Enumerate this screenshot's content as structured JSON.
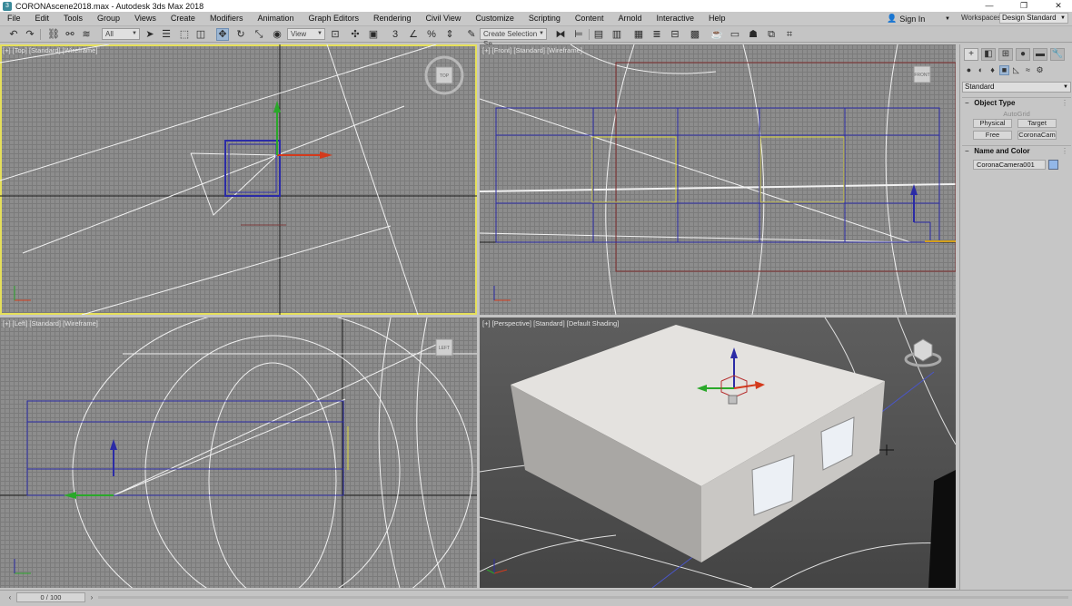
{
  "window": {
    "title": "CORONAscene2018.max - Autodesk 3ds Max 2018",
    "controls": [
      "—",
      "❐",
      "✕"
    ]
  },
  "menu": [
    "File",
    "Edit",
    "Tools",
    "Group",
    "Views",
    "Create",
    "Modifiers",
    "Animation",
    "Graph Editors",
    "Rendering",
    "Civil View",
    "Customize",
    "Scripting",
    "Content",
    "Arnold",
    "Interactive",
    "Help"
  ],
  "account": {
    "sign_in": "Sign In",
    "workspaces_label": "Workspaces:",
    "workspace": "Design Standard"
  },
  "toolbar": {
    "selection_filter": "All",
    "reference_coord": "View",
    "named_selection_placeholder": "Create Selection Se"
  },
  "viewports": {
    "top": "[+] [Top] [Standard] [Wireframe]",
    "front": "[+] [Front] [Standard] [Wireframe]",
    "left": "[+] [Left] [Standard] [Wireframe]",
    "perspective": "[+] [Perspective] [Standard] [Default Shading]",
    "viewcube_labels": {
      "top": "TOP",
      "front": "FRONT",
      "left": "LEFT"
    }
  },
  "command_panel": {
    "category": "Standard",
    "object_type_title": "Object Type",
    "autogrid": "AutoGrid",
    "buttons": [
      "Physical",
      "Target",
      "Free",
      "CoronaCam"
    ],
    "name_color_title": "Name and Color",
    "object_name": "CoronaCamera001",
    "object_color": "#93b7e8"
  },
  "timeline": {
    "frame": "0 / 100"
  }
}
